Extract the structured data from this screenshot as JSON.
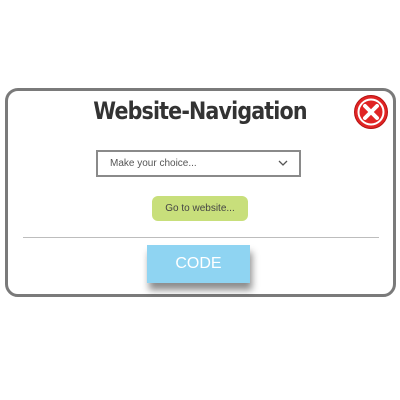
{
  "dialog": {
    "title": "Website-Navigation",
    "close_icon": "close-icon",
    "select": {
      "value": "Make your choice...",
      "options_visible": [
        "Make your choice..."
      ],
      "chevron_icon": "chevron-down-icon"
    },
    "go_button_label": "Go to website...",
    "code_button_label": "CODE"
  },
  "colors": {
    "panel_border": "#7a7a7a",
    "title_text": "#333333",
    "close_red": "#e02424",
    "go_button_bg": "#c8df7b",
    "code_button_bg": "#8fd4f2",
    "code_button_text": "#ffffff",
    "divider": "#bdbdbd"
  }
}
